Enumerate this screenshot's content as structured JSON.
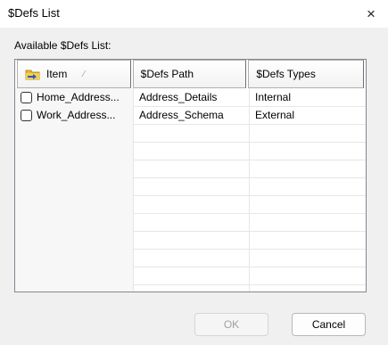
{
  "window": {
    "title": "$Defs List",
    "close_icon": "×"
  },
  "list_caption": "Available $Defs List:",
  "table": {
    "columns": [
      {
        "label": "Item",
        "icon": "folder-arrow-icon",
        "sort_indicator": "⁄"
      },
      {
        "label": "$Defs Path"
      },
      {
        "label": "$Defs Types"
      }
    ],
    "rows": [
      {
        "item": "Home_Address...",
        "path": "Address_Details",
        "type": "Internal",
        "checked": false
      },
      {
        "item": "Work_Address...",
        "path": "Address_Schema",
        "type": "External",
        "checked": false
      }
    ]
  },
  "buttons": {
    "ok": "OK",
    "cancel": "Cancel"
  }
}
